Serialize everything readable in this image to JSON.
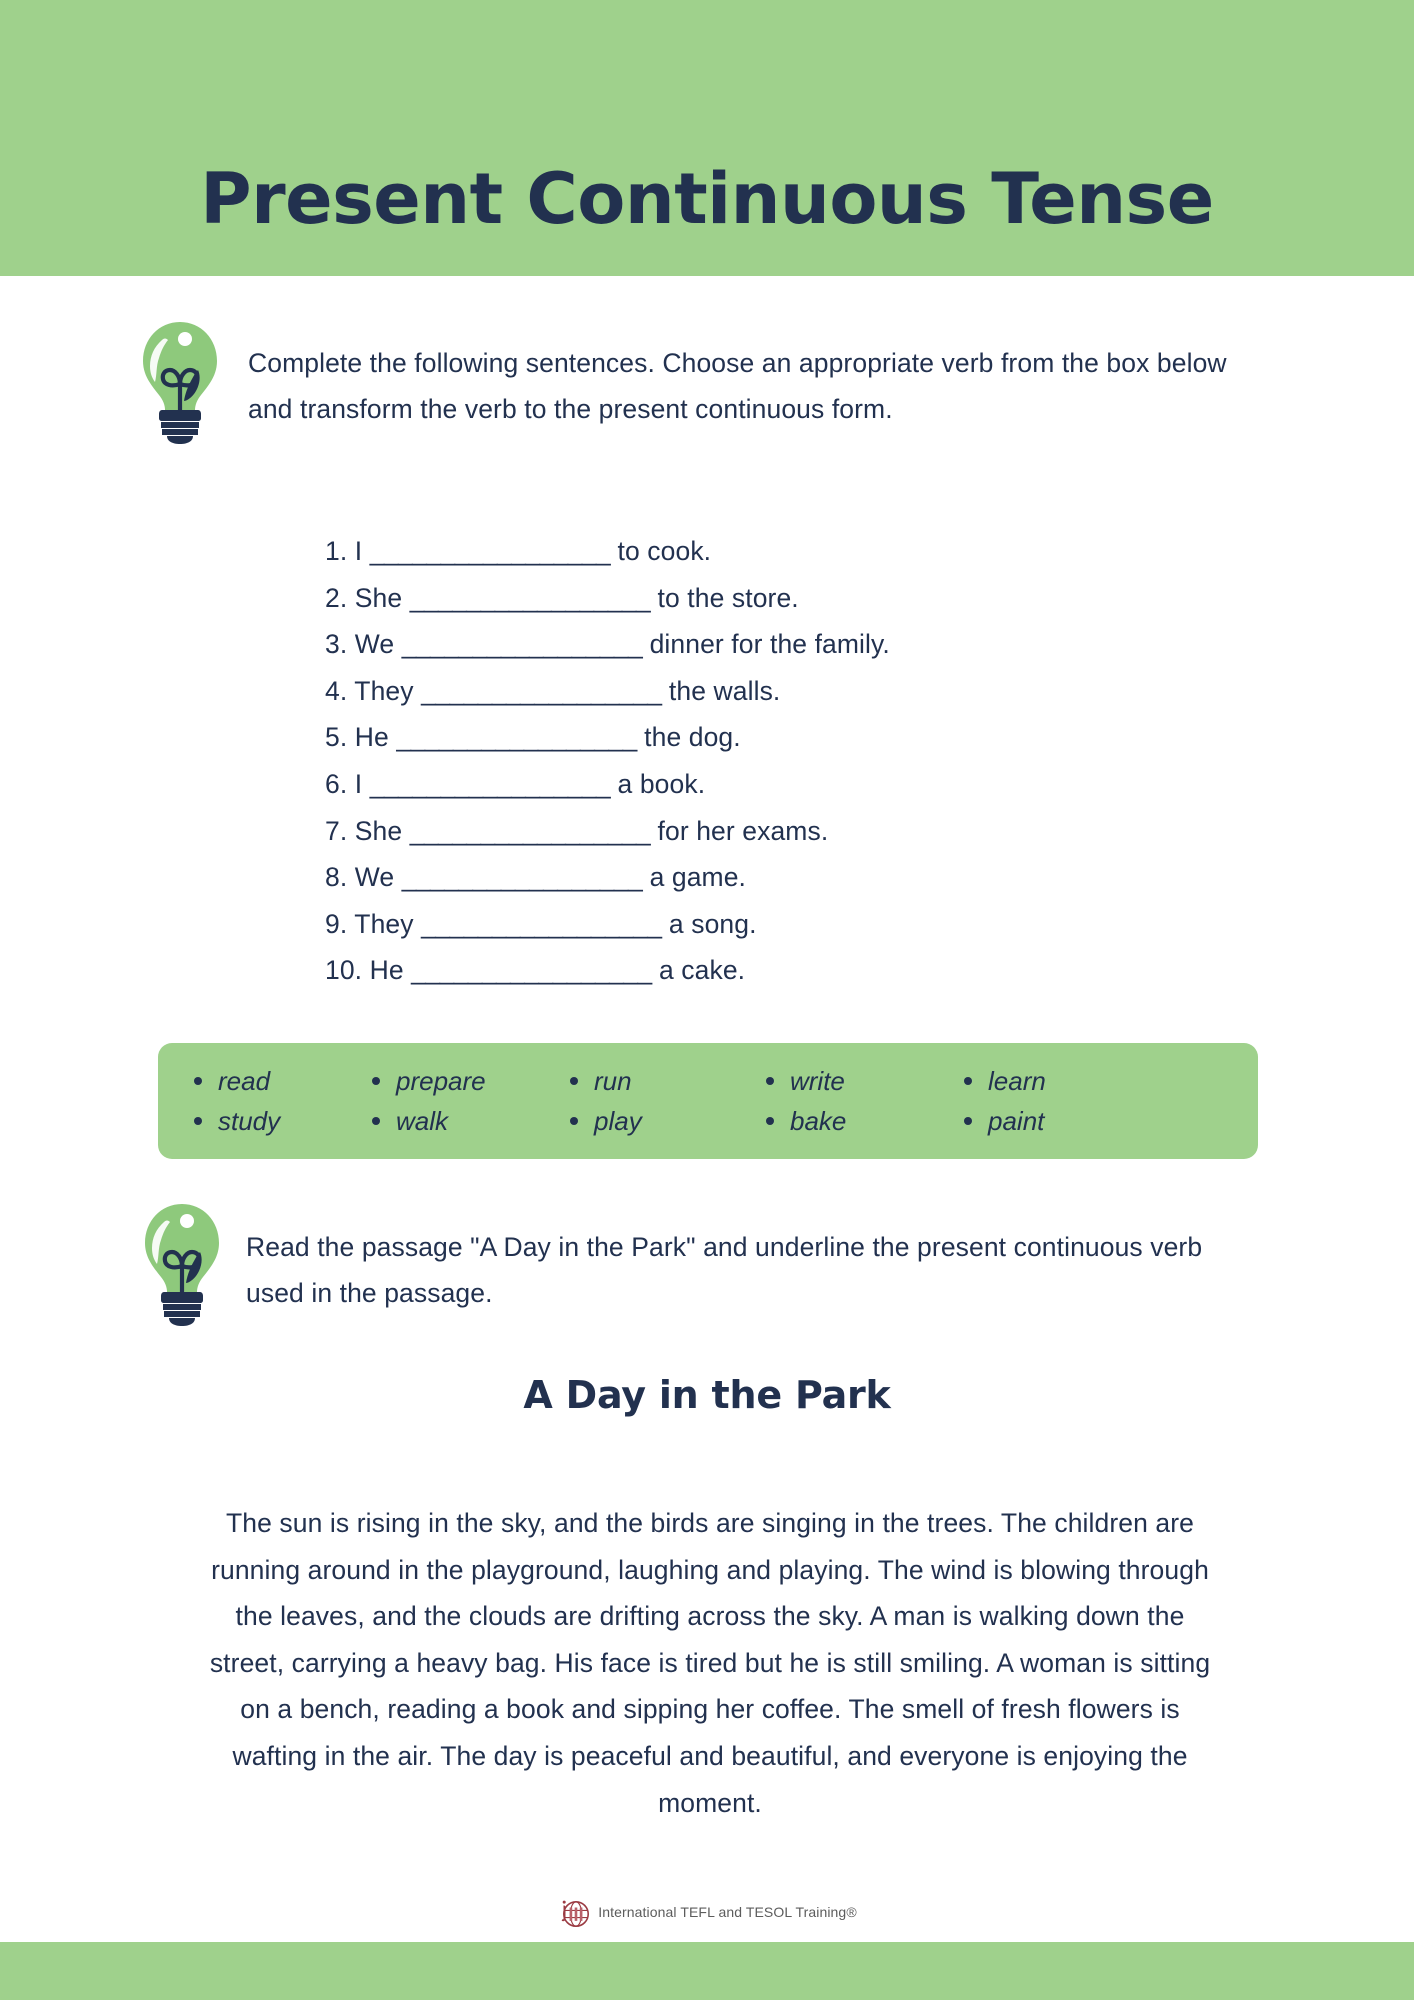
{
  "colors": {
    "band_green": "#9FD18C",
    "navy": "#22314F",
    "box_green": "#9FD18C",
    "logo_maroon": "#9B3B43",
    "footer_gray": "#5C5C5C"
  },
  "header": {
    "title": "Present Continuous Tense"
  },
  "instruction_1": {
    "icon": "lightbulb-icon",
    "text": "Complete the following sentences. Choose an appropriate verb from the box below and transform the verb to the present continuous form."
  },
  "sentences": [
    {
      "number": "1.",
      "subject": "I",
      "blank": "_________________",
      "tail": "to cook."
    },
    {
      "number": "2.",
      "subject": "She",
      "blank": "_________________",
      "tail": "to the store."
    },
    {
      "number": "3.",
      "subject": "We",
      "blank": "_________________",
      "tail": "dinner for the family."
    },
    {
      "number": "4.",
      "subject": "They",
      "blank": "_________________",
      "tail": "the walls."
    },
    {
      "number": "5.",
      "subject": "He",
      "blank": "_________________",
      "tail": "the dog."
    },
    {
      "number": "6.",
      "subject": "I",
      "blank": "_________________",
      "tail": "a book."
    },
    {
      "number": "7.",
      "subject": "She",
      "blank": "_________________",
      "tail": "for her exams."
    },
    {
      "number": "8.",
      "subject": "We",
      "blank": "_________________",
      "tail": "a game."
    },
    {
      "number": "9.",
      "subject": "They",
      "blank": "_________________",
      "tail": "a song."
    },
    {
      "number": "10.",
      "subject": "He",
      "blank": "_________________",
      "tail": "a cake."
    }
  ],
  "word_bank": {
    "words": [
      "read",
      "study",
      "prepare",
      "walk",
      "run",
      "play",
      "write",
      "bake",
      "learn",
      "paint"
    ]
  },
  "instruction_2": {
    "icon": "lightbulb-icon",
    "text": "Read the passage \"A Day in the Park\" and underline the present continuous verb used in the passage."
  },
  "passage": {
    "title": "A Day in the Park",
    "body": "The sun is rising in the sky, and the birds are singing in the trees. The children are running around in the playground, laughing and playing. The wind is blowing through the leaves, and the clouds are drifting across the sky. A man is walking down the street, carrying a heavy bag. His face is tired but he is still smiling. A woman is sitting on a bench, reading a book and sipping her coffee. The smell of fresh flowers is wafting in the air. The day is peaceful and beautiful, and everyone is enjoying the moment."
  },
  "footer": {
    "logo_mark": "ittt-globe-icon",
    "text": "International TEFL  and TESOL Training®"
  }
}
